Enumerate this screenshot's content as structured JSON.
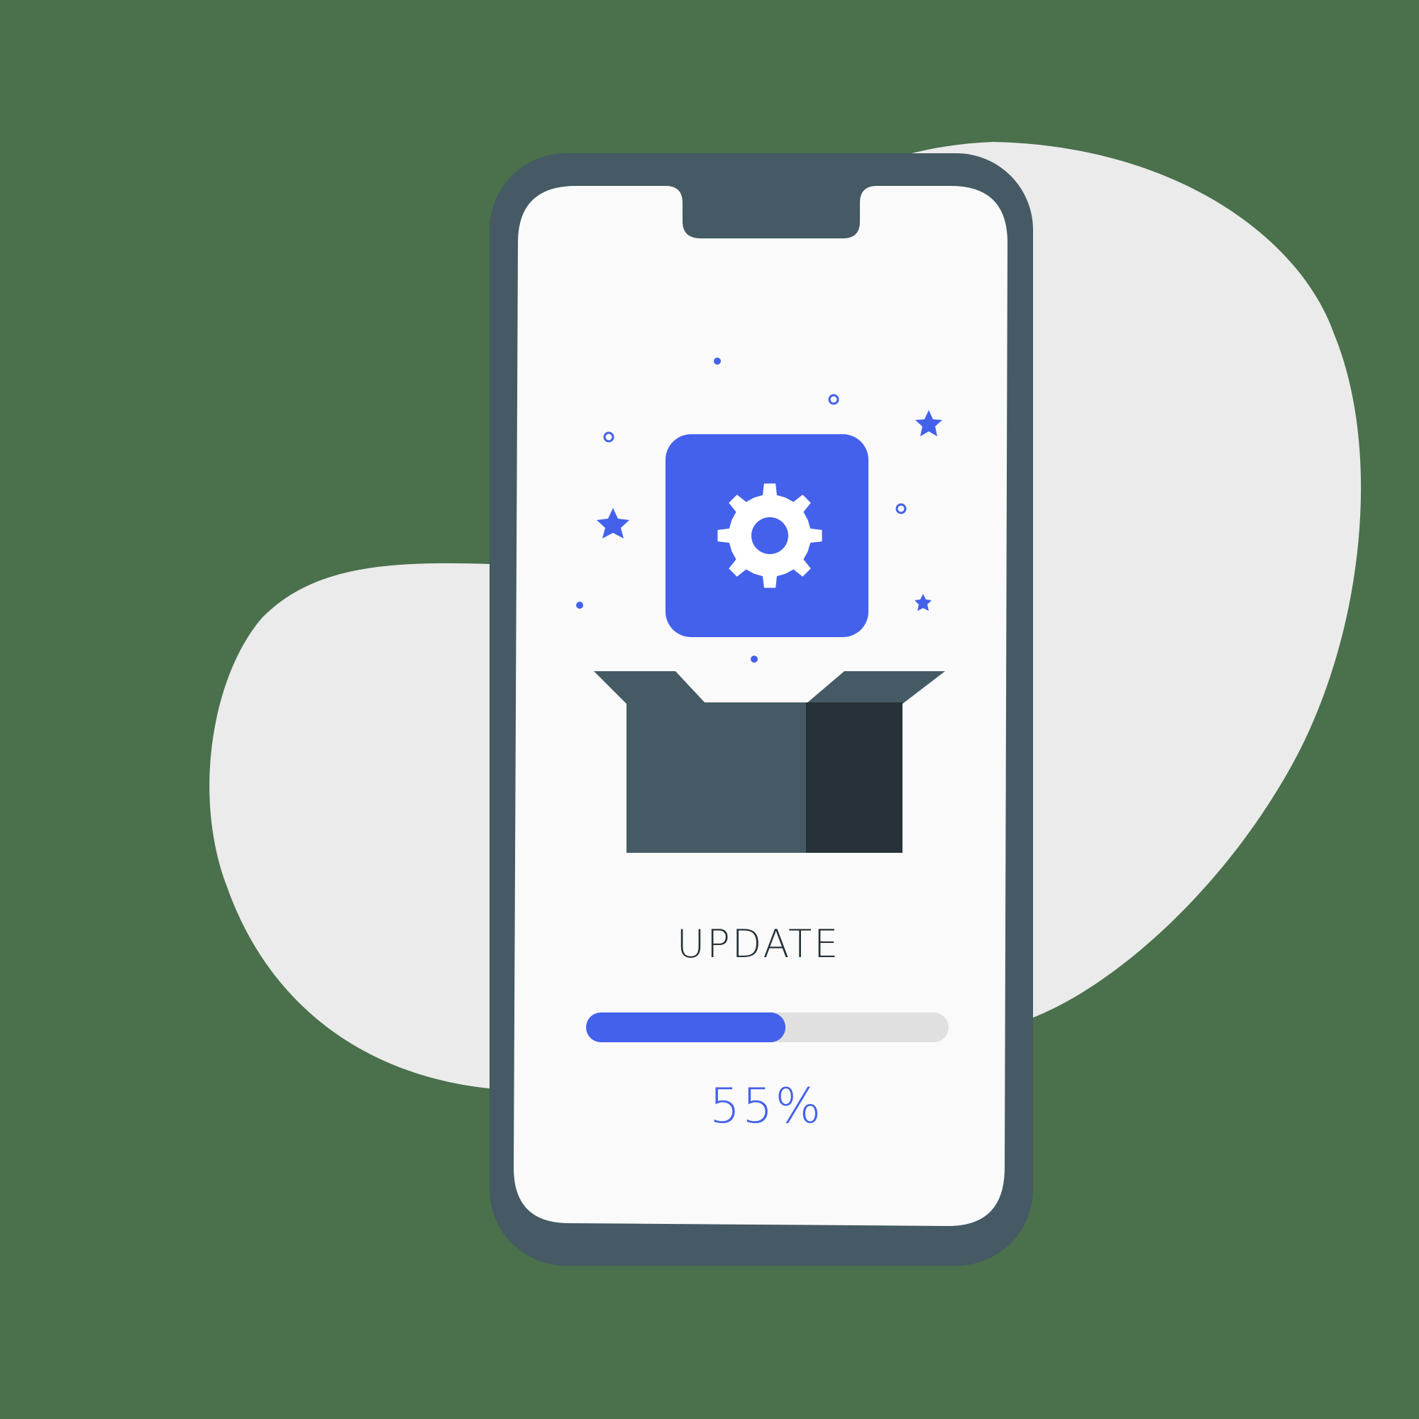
{
  "screen": {
    "title": "UPDATE",
    "progress_text": "55%"
  },
  "progress": {
    "value": 0.55
  },
  "icons": {
    "app_icon": "gear-icon",
    "package": "open-box-icon",
    "decorations": [
      "star-icon",
      "circle-dot-icon",
      "ring-dot-icon"
    ]
  },
  "colors": {
    "background": "#4a704c",
    "blob": "#ebebeb",
    "phone_body": "#455a64",
    "screen": "#fafafa",
    "accent": "#4461ec",
    "box_side": "#263238",
    "text": "#263238",
    "track": "#e0e0e0"
  }
}
